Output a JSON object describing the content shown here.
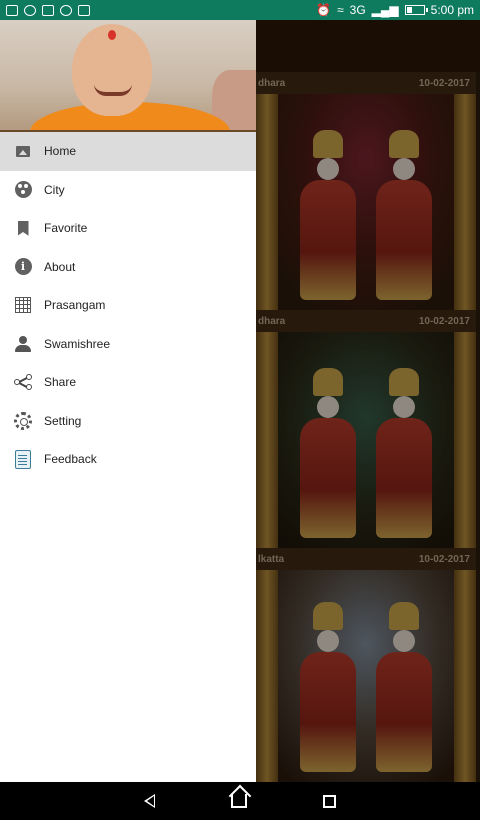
{
  "status_bar": {
    "network": "3G",
    "time": "5:00 pm",
    "accent": "#0e7a5e"
  },
  "gallery": {
    "cards": [
      {
        "location_fragment": "dhara",
        "date": "10-02-2017"
      },
      {
        "location_fragment": "dhara",
        "date": "10-02-2017"
      },
      {
        "location_fragment": "lkatta",
        "date": "10-02-2017"
      }
    ]
  },
  "drawer": {
    "menu": [
      {
        "label": "Home",
        "icon": "image-icon",
        "active": true
      },
      {
        "label": "City",
        "icon": "film-reel-icon"
      },
      {
        "label": "Favorite",
        "icon": "bookmark-icon"
      },
      {
        "label": "About",
        "icon": "info-icon"
      },
      {
        "label": "Prasangam",
        "icon": "calendar-icon"
      },
      {
        "label": "Swamishree",
        "icon": "person-icon"
      },
      {
        "label": "Share",
        "icon": "share-icon"
      },
      {
        "label": "Setting",
        "icon": "gear-icon"
      },
      {
        "label": "Feedback",
        "icon": "feedback-icon"
      }
    ]
  }
}
